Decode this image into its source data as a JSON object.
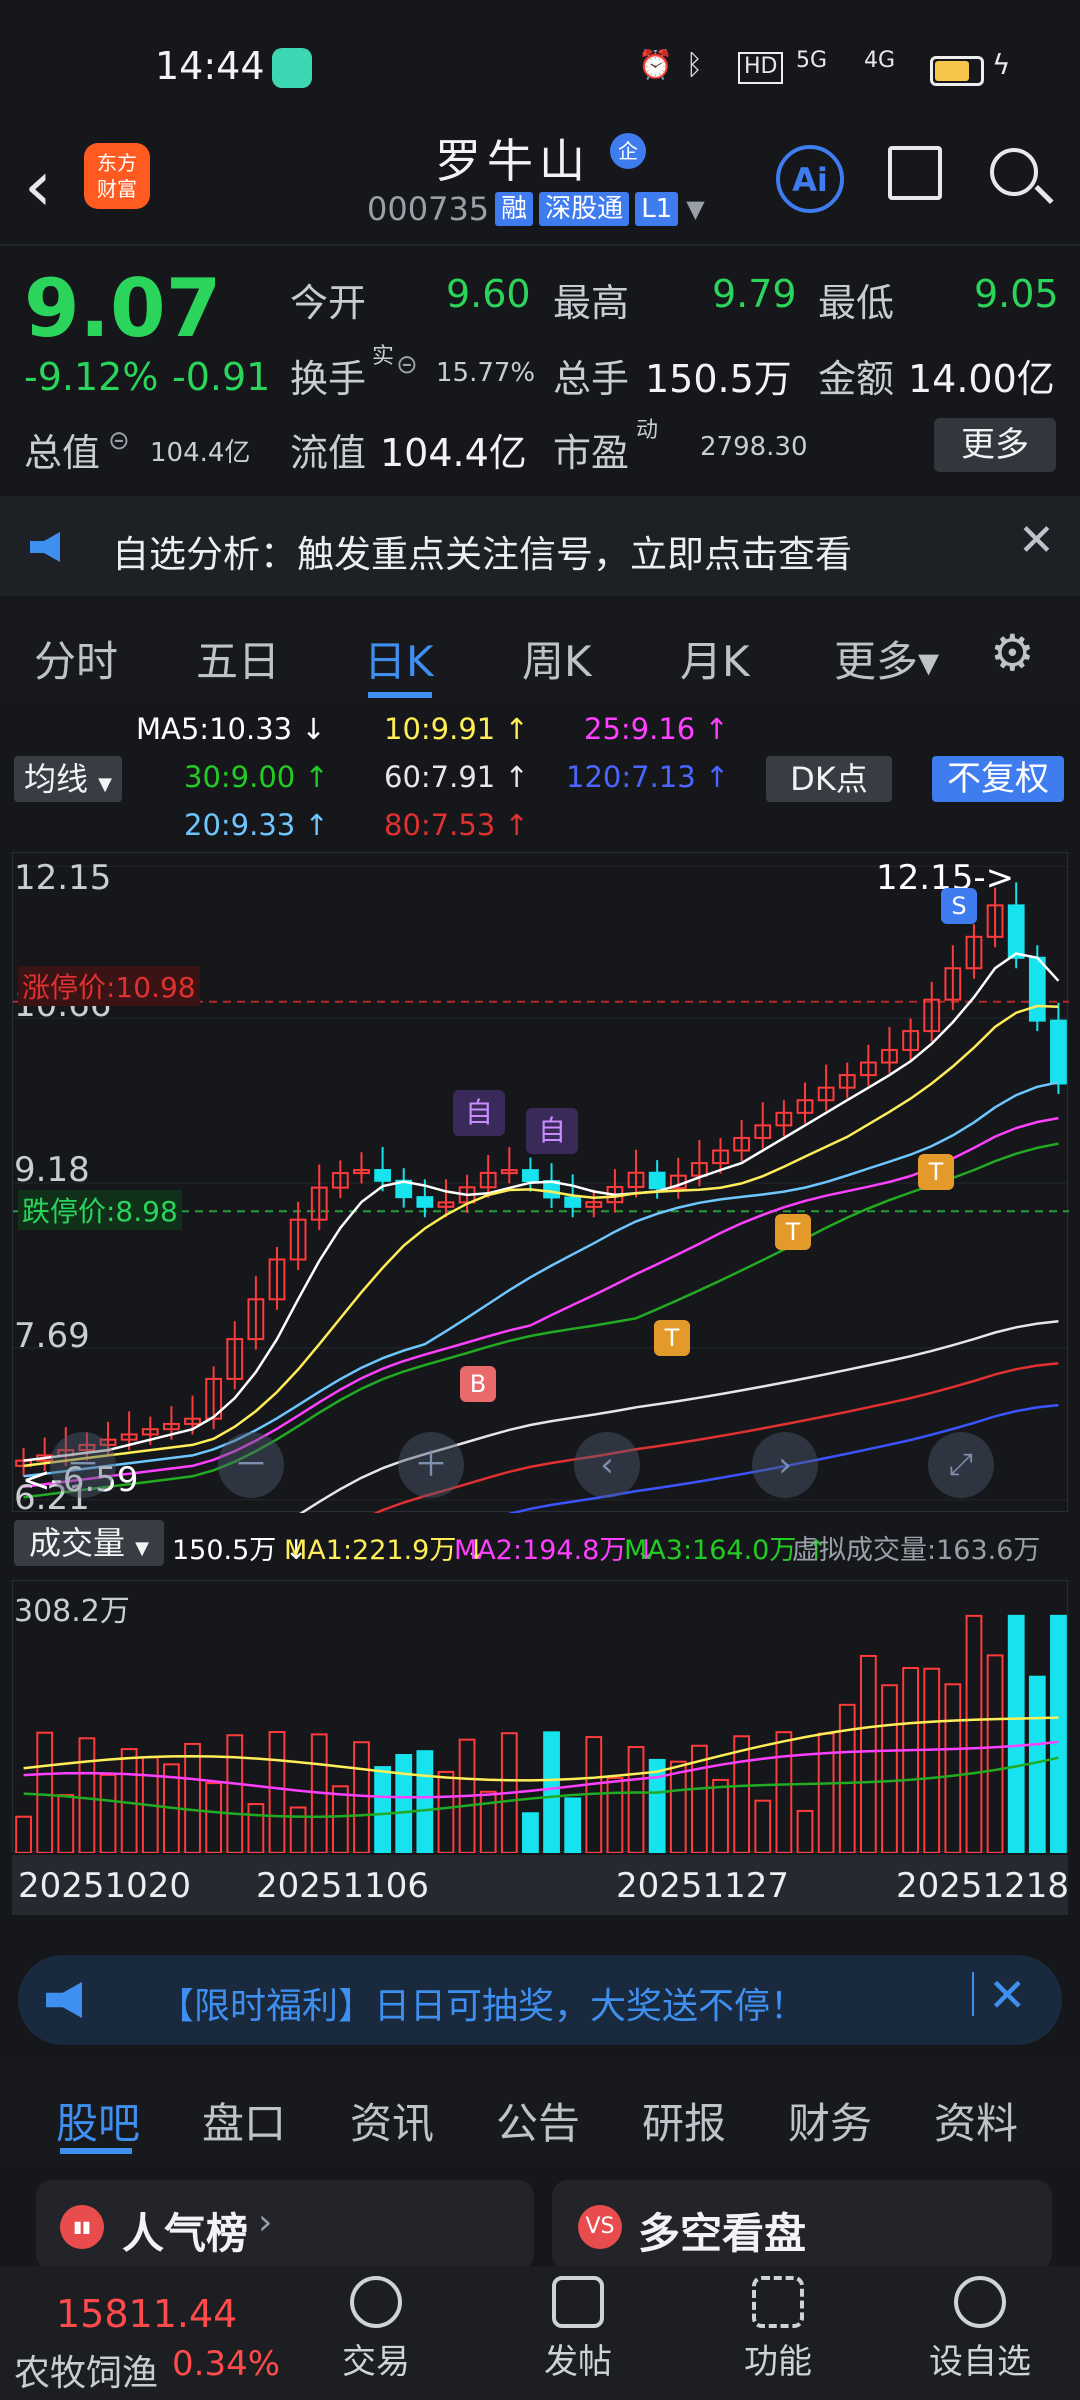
{
  "status": {
    "time": "14:44",
    "network": "5G",
    "network2": "4G"
  },
  "header": {
    "back_glyph": "‹",
    "logo_line1": "东方",
    "logo_line2": "财富",
    "name": "罗牛山",
    "name_badge": "企",
    "code": "000735",
    "tags": [
      "融",
      "深股通",
      "L1"
    ],
    "ai_label": "Ai"
  },
  "quote": {
    "price": "9.07",
    "change_pct": "-9.12%",
    "change_val": "-0.91",
    "open_label": "今开",
    "open": "9.60",
    "high_label": "最高",
    "high": "9.79",
    "low_label": "最低",
    "low": "9.05",
    "turnover_label": "换手",
    "turnover_sup": "实",
    "turnover": "15.77%",
    "volume_label": "总手",
    "volume": "150.5万",
    "amount_label": "金额",
    "amount": "14.00亿",
    "mktcap_label": "总值",
    "mktcap": "104.4亿",
    "float_label": "流值",
    "float": "104.4亿",
    "pe_label": "市盈",
    "pe_sup": "动",
    "pe": "2798.30",
    "more_label": "更多"
  },
  "notice": {
    "text": "自选分析：触发重点关注信号，立即点击查看",
    "close": "✕"
  },
  "period_tabs": [
    "分时",
    "五日",
    "日K",
    "周K",
    "月K",
    "更多▾"
  ],
  "period_active": 2,
  "ma_legend": {
    "ma5": "MA5:10.33 ↓",
    "ma10": "10:9.91 ↑",
    "ma25": "25:9.16 ↑",
    "ma30": "30:9.00 ↑",
    "ma60": "60:7.91 ↑",
    "ma120": "120:7.13 ↑",
    "ma20": "20:9.33 ↑",
    "ma80": "80:7.53 ↑",
    "junxian": "均线",
    "dk": "DK点",
    "fuquan": "不复权"
  },
  "kchart": {
    "y_labels": [
      "12.15",
      "10.66",
      "9.18",
      "7.69",
      "6.21"
    ],
    "limit_up": "涨停价:10.98",
    "limit_down": "跌停价:8.98",
    "max_label": "12.15->",
    "min_label": "<-6.59",
    "marker_zi": "自",
    "marker_b": "B",
    "marker_s": "S",
    "marker_t": "T",
    "watermark": "东方财富",
    "colors": {
      "up": "#ff3b3b",
      "down": "#16e3ee",
      "ma5": "#ffffff",
      "ma10": "#ffee58",
      "ma20": "#6ec6ff",
      "ma25": "#ff40ff",
      "ma30": "#22aa22",
      "ma60": "#e6e6e6",
      "ma80": "#e03030",
      "ma120": "#3a55ff"
    }
  },
  "volume": {
    "label": "成交量",
    "current": "150.5万 ↓",
    "ma1": "MA1:221.9万 ↓",
    "ma2": "MA2:194.8万 ↓",
    "ma3": "MA3:164.0万 ↑",
    "virtual": "虚拟成交量:163.6万",
    "top_label": "308.2万"
  },
  "dates": [
    "20251020",
    "20251106",
    "20251127",
    "20251218"
  ],
  "promo": {
    "text": "【限时福利】日日可抽奖，大奖送不停！",
    "close": "✕"
  },
  "bottom_tabs": [
    "股吧",
    "盘口",
    "资讯",
    "公告",
    "研报",
    "财务",
    "资料"
  ],
  "cards": [
    {
      "title": "人气榜",
      "icon": "▮▮"
    },
    {
      "title": "多空看盘",
      "icon": "VS"
    }
  ],
  "bottom_nav": {
    "index_value": "15811.44",
    "index_name": "农牧饲渔",
    "index_change": "0.34%",
    "items": [
      "交易",
      "发帖",
      "功能",
      "设自选"
    ]
  }
}
